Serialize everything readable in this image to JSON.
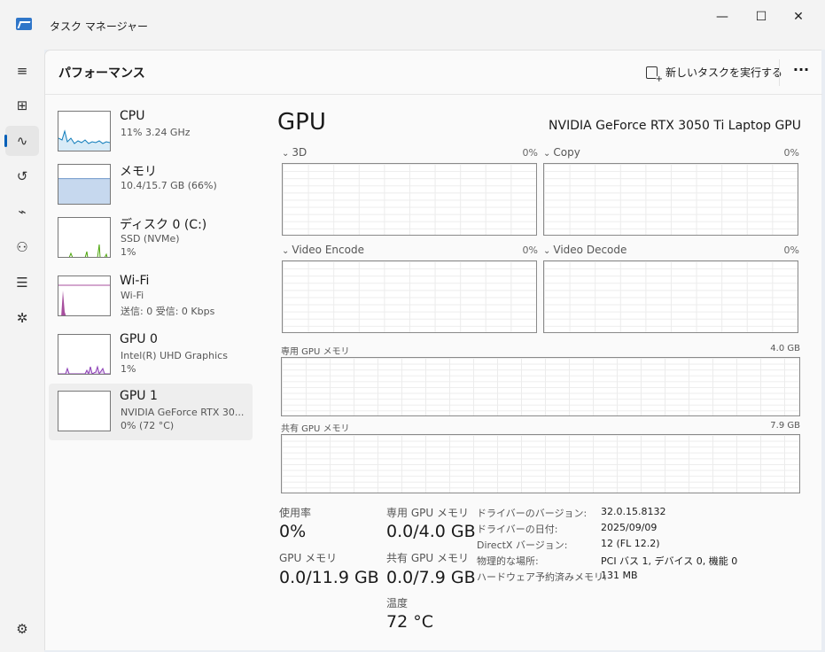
{
  "window": {
    "title": "タスク マネージャー",
    "minimize_glyph": "—",
    "maximize_glyph": "☐",
    "close_glyph": "✕"
  },
  "nav": {
    "icons": [
      "hamburger-icon",
      "processes-icon",
      "performance-icon",
      "app-history-icon",
      "startup-apps-icon",
      "users-icon",
      "details-icon",
      "services-icon",
      "settings-icon"
    ],
    "glyphs": {
      "menu": "≡",
      "processes": "⊞",
      "performance": "∿",
      "history": "↺",
      "startup": "⌁",
      "users": "⚇",
      "details": "☰",
      "services": "✲",
      "settings": "⚙"
    }
  },
  "header": {
    "title": "パフォーマンス",
    "new_task_label": "新しいタスクを実行する",
    "more_glyph": "···"
  },
  "perf_items": [
    {
      "name": "CPU",
      "line1": "11%  3.24 GHz",
      "line2": "",
      "color": "#117dbb"
    },
    {
      "name": "メモリ",
      "line1": "10.4/15.7 GB (66%)",
      "line2": "",
      "color": "#6f97c9",
      "fill_fraction": 0.66
    },
    {
      "name": "ディスク 0 (C:)",
      "line1": "SSD (NVMe)",
      "line2": "1%",
      "color": "#4da60c"
    },
    {
      "name": "Wi-Fi",
      "line1": "Wi-Fi",
      "line2": "送信: 0 受信: 0 Kbps",
      "color": "#a74f9e"
    },
    {
      "name": "GPU 0",
      "line1": "Intel(R) UHD Graphics",
      "line2": "1%",
      "color": "#8c3eb5"
    },
    {
      "name": "GPU 1",
      "line1": "NVIDIA GeForce RTX 30...",
      "line2": "0%  (72 °C)",
      "color": "#8c3eb5"
    }
  ],
  "detail": {
    "title": "GPU",
    "model": "NVIDIA GeForce RTX 3050 Ti Laptop GPU",
    "engines": [
      {
        "name": "3D",
        "percent": "0%"
      },
      {
        "name": "Copy",
        "percent": "0%"
      },
      {
        "name": "Video Encode",
        "percent": "0%"
      },
      {
        "name": "Video Decode",
        "percent": "0%"
      }
    ],
    "chevron": "⌄",
    "dedicated_memory": {
      "label": "専用 GPU メモリ",
      "max": "4.0 GB"
    },
    "shared_memory": {
      "label": "共有 GPU メモリ",
      "max": "7.9 GB"
    },
    "stats": {
      "utilization_label": "使用率",
      "utilization_value": "0%",
      "dedicated_label": "専用 GPU メモリ",
      "dedicated_value": "0.0/4.0 GB",
      "gpu_memory_label": "GPU メモリ",
      "gpu_memory_value": "0.0/11.9 GB",
      "shared_label": "共有 GPU メモリ",
      "shared_value": "0.0/7.9 GB",
      "temperature_label": "温度",
      "temperature_value": "72 °C"
    },
    "properties": [
      {
        "key": "ドライバーのバージョン:",
        "value": "32.0.15.8132"
      },
      {
        "key": "ドライバーの日付:",
        "value": "2025/09/09"
      },
      {
        "key": "DirectX バージョン:",
        "value": "12 (FL 12.2)"
      },
      {
        "key": "物理的な場所:",
        "value": "PCI バス 1, デバイス 0, 機能 0"
      },
      {
        "key": "ハードウェア予約済みメモリ:",
        "value": "131 MB"
      }
    ]
  }
}
